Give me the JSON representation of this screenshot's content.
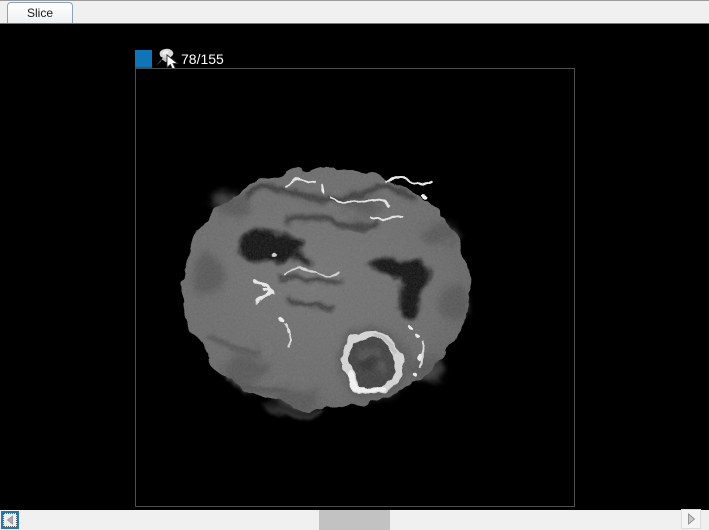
{
  "tabs": {
    "items": [
      {
        "label": "Slice",
        "active": true
      }
    ],
    "bar_background": "#f0f0f0",
    "pane_border_color": "#4f7fae"
  },
  "viewport": {
    "slice_counter": "78/155",
    "swatch_color": "#1173b8",
    "marker_color": "#85c8ec",
    "frame_color": "#4f4f4f",
    "background": "#000000",
    "image_description": "axial brain MRI slice with bright ring-enhancing lesion"
  },
  "icons": {
    "pin": "pushpin-icon",
    "cursor": "mouse-cursor-icon",
    "scroll_left": "triangle-left-icon",
    "scroll_right": "triangle-right-icon"
  },
  "scrollbar": {
    "track_color": "#f0f0f0",
    "thumb_color": "#c2c2c2",
    "focus_border_color": "#2478b5"
  }
}
